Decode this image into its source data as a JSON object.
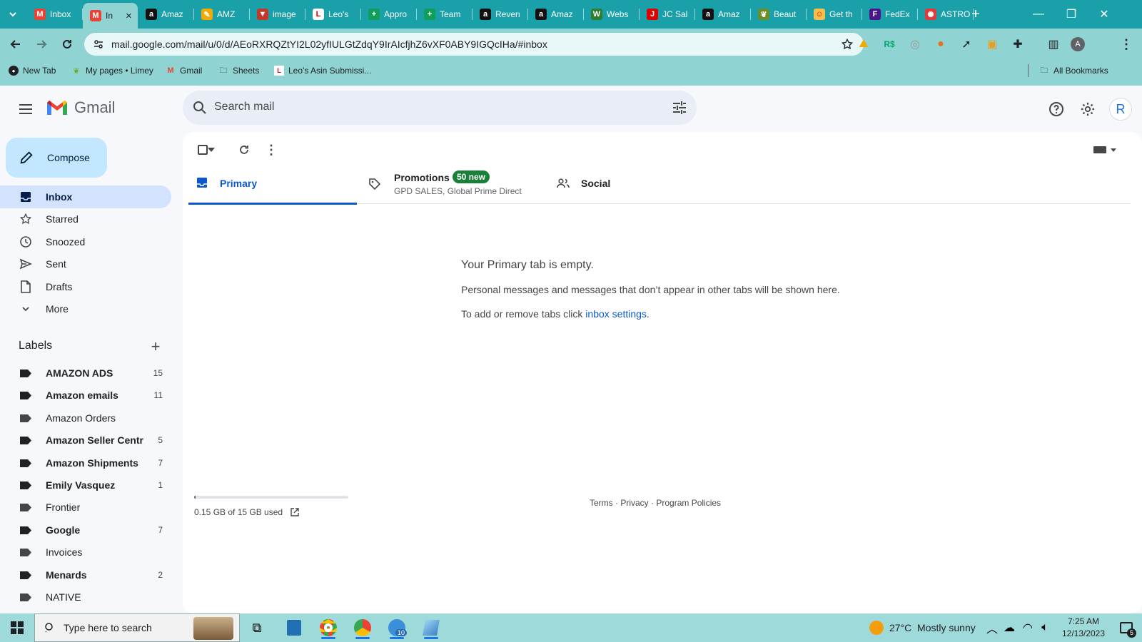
{
  "browser": {
    "tabs": [
      {
        "title": "Inbox",
        "favicon": "gmail",
        "active": false
      },
      {
        "title": "In",
        "favicon": "gmail",
        "active": true
      },
      {
        "title": "Amaz",
        "favicon": "amazon"
      },
      {
        "title": "AMZ",
        "favicon": "pencil"
      },
      {
        "title": "image",
        "favicon": "vivaldi"
      },
      {
        "title": "Leo's",
        "favicon": "leo"
      },
      {
        "title": "Appro",
        "favicon": "sheets"
      },
      {
        "title": "Team",
        "favicon": "sheets"
      },
      {
        "title": "Reven",
        "favicon": "amazon"
      },
      {
        "title": "Amaz",
        "favicon": "amazon"
      },
      {
        "title": "Webs",
        "favicon": "w"
      },
      {
        "title": "JC Sal",
        "favicon": "jc"
      },
      {
        "title": "Amaz",
        "favicon": "amazon"
      },
      {
        "title": "Beaut",
        "favicon": "leaf"
      },
      {
        "title": "Get th",
        "favicon": "smiley"
      },
      {
        "title": "FedEx",
        "favicon": "fedex"
      },
      {
        "title": "ASTRO",
        "favicon": "astro"
      }
    ],
    "new_tab": "+",
    "url": "mail.google.com/mail/u/0/d/AEoRXRQZtYI2L02yfIULGtZdqY9IrAIcfjhZ6vXF0ABY9IGQcIHa/#inbox",
    "bookmarks": [
      {
        "label": "New Tab"
      },
      {
        "label": "My pages • Limey"
      },
      {
        "label": "Gmail"
      },
      {
        "label": "Sheets"
      },
      {
        "label": "Leo's Asin Submissi..."
      }
    ],
    "all_bookmarks": "All Bookmarks",
    "profile_initial": "A"
  },
  "gmail": {
    "logo_text": "Gmail",
    "search_placeholder": "Search mail",
    "compose_label": "Compose",
    "avatar_initial": "R",
    "nav": [
      {
        "label": "Inbox",
        "icon": "inbox-icon"
      },
      {
        "label": "Starred",
        "icon": "star-icon"
      },
      {
        "label": "Snoozed",
        "icon": "clock-icon"
      },
      {
        "label": "Sent",
        "icon": "send-icon"
      },
      {
        "label": "Drafts",
        "icon": "draft-icon"
      },
      {
        "label": "More",
        "icon": "chevron-down-icon"
      }
    ],
    "labels_heading": "Labels",
    "labels": [
      {
        "label": "AMAZON ADS",
        "count": "15",
        "bold": true
      },
      {
        "label": "Amazon emails",
        "count": "11",
        "bold": true
      },
      {
        "label": "Amazon Orders",
        "count": "",
        "bold": false
      },
      {
        "label": "Amazon Seller Centr",
        "count": "5",
        "bold": true
      },
      {
        "label": "Amazon Shipments",
        "count": "7",
        "bold": true
      },
      {
        "label": "Emily Vasquez",
        "count": "1",
        "bold": true
      },
      {
        "label": "Frontier",
        "count": "",
        "bold": false
      },
      {
        "label": "Google",
        "count": "7",
        "bold": true
      },
      {
        "label": "Invoices",
        "count": "",
        "bold": false
      },
      {
        "label": "Menards",
        "count": "2",
        "bold": true
      },
      {
        "label": "NATIVE",
        "count": "",
        "bold": false
      }
    ],
    "tabs": {
      "primary": "Primary",
      "promotions": "Promotions",
      "promotions_badge": "50 new",
      "promotions_sub": "GPD SALES, Global Prime Direct",
      "social": "Social"
    },
    "empty": {
      "title": "Your Primary tab is empty.",
      "line1": "Personal messages and messages that don’t appear in other tabs will be shown here.",
      "line2_prefix": "To add or remove tabs click ",
      "line2_link": "inbox settings",
      "line2_suffix": "."
    },
    "storage": {
      "text": "0.15 GB of 15 GB used",
      "used_fraction": 0.01
    },
    "footer": {
      "terms": "Terms",
      "sep": " · ",
      "privacy": "Privacy",
      "policies": "Program Policies"
    }
  },
  "taskbar": {
    "search_placeholder": "Type here to search",
    "weather": "27°C  Mostly sunny",
    "time": "7:25 AM",
    "date": "12/13/2023",
    "notif_count": "5",
    "chrome_badge_count": "10"
  },
  "colors": {
    "accent": "#0b57d0",
    "compose_bg": "#c2e7ff",
    "selected_nav": "#d3e3fd",
    "badge_green": "#188038",
    "chrome_teal": "#1aa0a8"
  }
}
